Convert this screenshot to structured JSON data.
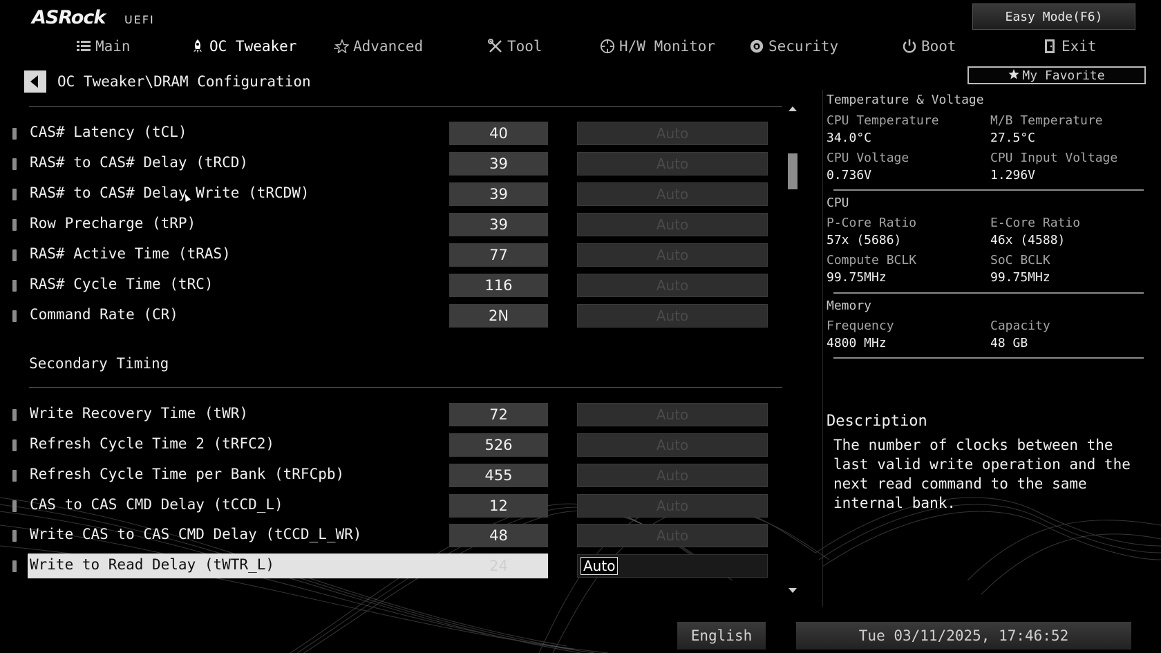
{
  "brand": {
    "logo": "ASRock",
    "sub": "UEFI"
  },
  "easy_mode_label": "Easy Mode(F6)",
  "nav": [
    {
      "label": "Main",
      "icon": "list-icon",
      "active": false
    },
    {
      "label": "OC Tweaker",
      "icon": "rocket-icon",
      "active": true
    },
    {
      "label": "Advanced",
      "icon": "star-icon",
      "active": false
    },
    {
      "label": "Tool",
      "icon": "tools-icon",
      "active": false
    },
    {
      "label": "H/W Monitor",
      "icon": "crosshair-icon",
      "active": false
    },
    {
      "label": "Security",
      "icon": "shield-icon",
      "active": false
    },
    {
      "label": "Boot",
      "icon": "power-icon",
      "active": false
    },
    {
      "label": "Exit",
      "icon": "exit-door-icon",
      "active": false
    }
  ],
  "breadcrumb": "OC Tweaker\\DRAM Configuration",
  "primary_rows": [
    {
      "label": "CAS# Latency (tCL)",
      "value": "40",
      "option": "Auto"
    },
    {
      "label": "RAS# to CAS# Delay (tRCD)",
      "value": "39",
      "option": "Auto"
    },
    {
      "label": "RAS# to CAS# Delay Write (tRCDW)",
      "value": "39",
      "option": "Auto"
    },
    {
      "label": "Row Precharge (tRP)",
      "value": "39",
      "option": "Auto"
    },
    {
      "label": "RAS# Active Time (tRAS)",
      "value": "77",
      "option": "Auto"
    },
    {
      "label": "RAS# Cycle Time (tRC)",
      "value": "116",
      "option": "Auto"
    },
    {
      "label": "Command Rate (CR)",
      "value": "2N",
      "option": "Auto"
    }
  ],
  "secondary_title": "Secondary Timing",
  "secondary_rows": [
    {
      "label": "Write Recovery Time (tWR)",
      "value": "72",
      "option": "Auto"
    },
    {
      "label": "Refresh Cycle Time 2 (tRFC2)",
      "value": "526",
      "option": "Auto"
    },
    {
      "label": "Refresh Cycle Time per Bank (tRFCpb)",
      "value": "455",
      "option": "Auto"
    },
    {
      "label": "CAS to CAS CMD Delay (tCCD_L)",
      "value": "12",
      "option": "Auto"
    },
    {
      "label": "Write CAS to CAS CMD Delay (tCCD_L_WR)",
      "value": "48",
      "option": "Auto"
    },
    {
      "label": "Write to Read Delay (tWTR_L)",
      "value": "24",
      "option": "Auto",
      "selected": true
    }
  ],
  "favorite_label": "My Favorite",
  "monitor": {
    "temp_title": "Temperature & Voltage",
    "cpu_temp_label": "CPU Temperature",
    "cpu_temp": "34.0°C",
    "mb_temp_label": "M/B Temperature",
    "mb_temp": "27.5°C",
    "cpu_volt_label": "CPU Voltage",
    "cpu_volt": "0.736V",
    "cpu_input_label": "CPU Input Voltage",
    "cpu_input": "1.296V",
    "cpu_title": "CPU",
    "pcore_label": "P-Core Ratio",
    "pcore": "57x (5686)",
    "ecore_label": "E-Core Ratio",
    "ecore": "46x (4588)",
    "bclk_label": "Compute BCLK",
    "bclk": "99.75MHz",
    "soc_label": "SoC BCLK",
    "soc": "99.75MHz",
    "mem_title": "Memory",
    "freq_label": "Frequency",
    "freq": "4800 MHz",
    "cap_label": "Capacity",
    "cap": "48 GB"
  },
  "description": {
    "title": "Description",
    "text": "The number of clocks between the last valid write operation and the next read command to the same internal bank."
  },
  "footer": {
    "language": "English",
    "datetime": "Tue 03/11/2025, 17:46:52"
  }
}
